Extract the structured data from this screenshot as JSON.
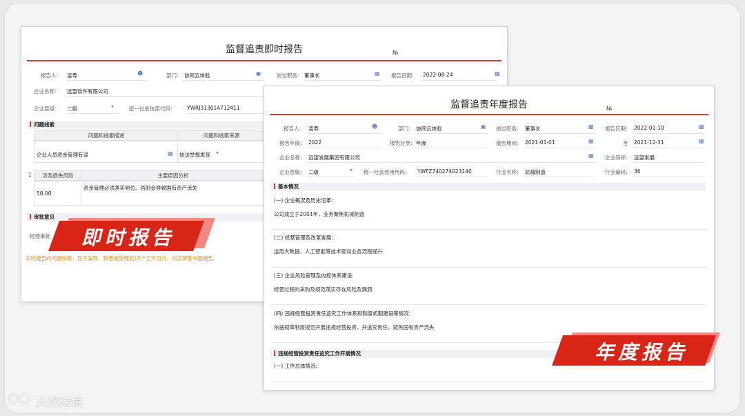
{
  "realtime": {
    "title": "监督追责即时报告",
    "no_label": "№",
    "reporter_label": "报告人:",
    "reporter": "凌寿",
    "dept_label": "部门:",
    "dept": "协同云体验",
    "post_label": "岗位职务:",
    "post": "董事长",
    "date_label": "报告日期:",
    "date": "2022-08-24",
    "company_label": "企业名称:",
    "company": "远望软件有限公司",
    "level_label": "企业层级:",
    "level": "二级",
    "credit_label": "统一社会信用代码:",
    "credit": "YWRJ313014712411",
    "section_clues": "问题线索",
    "col_desc": "问题和线索描述",
    "col_source": "问题和线索来源",
    "row_desc": "企业人员资金管理有误",
    "row_source": "信访举报发现",
    "row_index": "1",
    "col_loss": "涉及损失风险",
    "col_cause": "主要原因分析",
    "loss_value": "50.00",
    "cause_text": "资金管理必须落实到位。否则会导致国有资产流失",
    "section_opinion": "审批意见",
    "opinion_hint": "经理审批",
    "warning": "实时报告的问题线索，应于发现、获悉或受理后15个工作日内，向监督委书面报告。"
  },
  "annual": {
    "title": "监督追责年度报告",
    "no_label": "№",
    "reporter_label": "报告人:",
    "reporter": "凌寿",
    "dept_label": "部门:",
    "dept": "协同云体验",
    "post_label": "岗位职务:",
    "post": "董事长",
    "date_label": "报告日期:",
    "date": "2022-01-10",
    "year_label": "报告年度:",
    "year": "2022",
    "category_label": "报告分类:",
    "category": "年度",
    "period_label": "报告期间:",
    "period_start": "2021-01-01",
    "to_label": "至",
    "period_end": "2021-12-31",
    "company_label": "企业名称:",
    "company": "远望发展集团有限公司",
    "abbr_label": "企业简称:",
    "abbr": "远望发展",
    "level_label": "企业层级:",
    "level": "二级",
    "credit_label": "统一社会信用代码:",
    "credit": "YWFZ740274023140",
    "industry_label": "行业名称:",
    "industry": "机械制造",
    "industry_code_label": "行业编码:",
    "industry_code": "36",
    "section_basic": "基本情况",
    "sub1": "(一) 企业概况及历史沿革:",
    "text1": "公司成立于2001年，业务聚焦机械制造",
    "sub2": "(二) 经营管理及改革发展:",
    "text2": "运用大数据、人工智能等技术驱动业务流程提升",
    "sub3": "(三) 企业风险管理及内控体系建设:",
    "text3": "经营过程的采购及规范落实存在风险及漏洞",
    "sub4": "(四) 违规经营投资责任追究工作体系和制度机制建设等情况:",
    "text4": "依据规章制度规范开展违规经营投资，并追究责任，避免国有资产流失",
    "section_work": "违规经营投资责任追究工作开展情况",
    "sub5": "(一) 工作总体情况:"
  },
  "banners": {
    "realtime": "即时报告",
    "annual": "年度报告"
  },
  "watermark": "大数跨境",
  "colors": {
    "accent": "#e13a2c",
    "banner": "#d92516",
    "warning": "#f08a00"
  }
}
